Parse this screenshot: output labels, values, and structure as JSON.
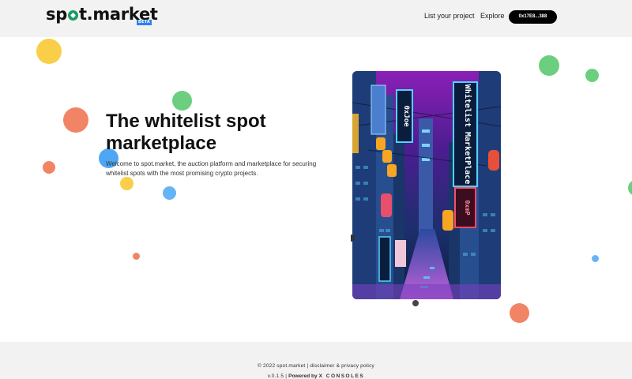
{
  "header": {
    "logo_text": "spot.market",
    "logo_prefix": "sp",
    "logo_suffix": "t.market",
    "beta": "BETA",
    "nav": {
      "list_project": "List your project",
      "explore": "Explore"
    },
    "wallet": "0x17E8...388"
  },
  "hero": {
    "title": "The whitelist spot marketplace",
    "subtitle": "Welcome to spot.market, the auction platform and marketplace for securing whitelist spots with the most promising crypto projects."
  },
  "art": {
    "signs": [
      "Whitelist MarketPlace",
      "0xJoe",
      "0xmP"
    ]
  },
  "footer": {
    "copyright": "© 2022 spot.market",
    "disclaimer": "disclaimer & privacy policy",
    "separator": "|",
    "version": "v.0.1.5",
    "powered_label": "Powered by",
    "powered_by": "X CONSOLES"
  },
  "colors": {
    "accent_green": "#1a9a63",
    "beta_blue": "#2f80ed",
    "dot_yellow": "#f9cf4a",
    "dot_coral": "#f28466",
    "dot_green": "#6ccf7f",
    "dot_blue": "#65b5f6"
  }
}
